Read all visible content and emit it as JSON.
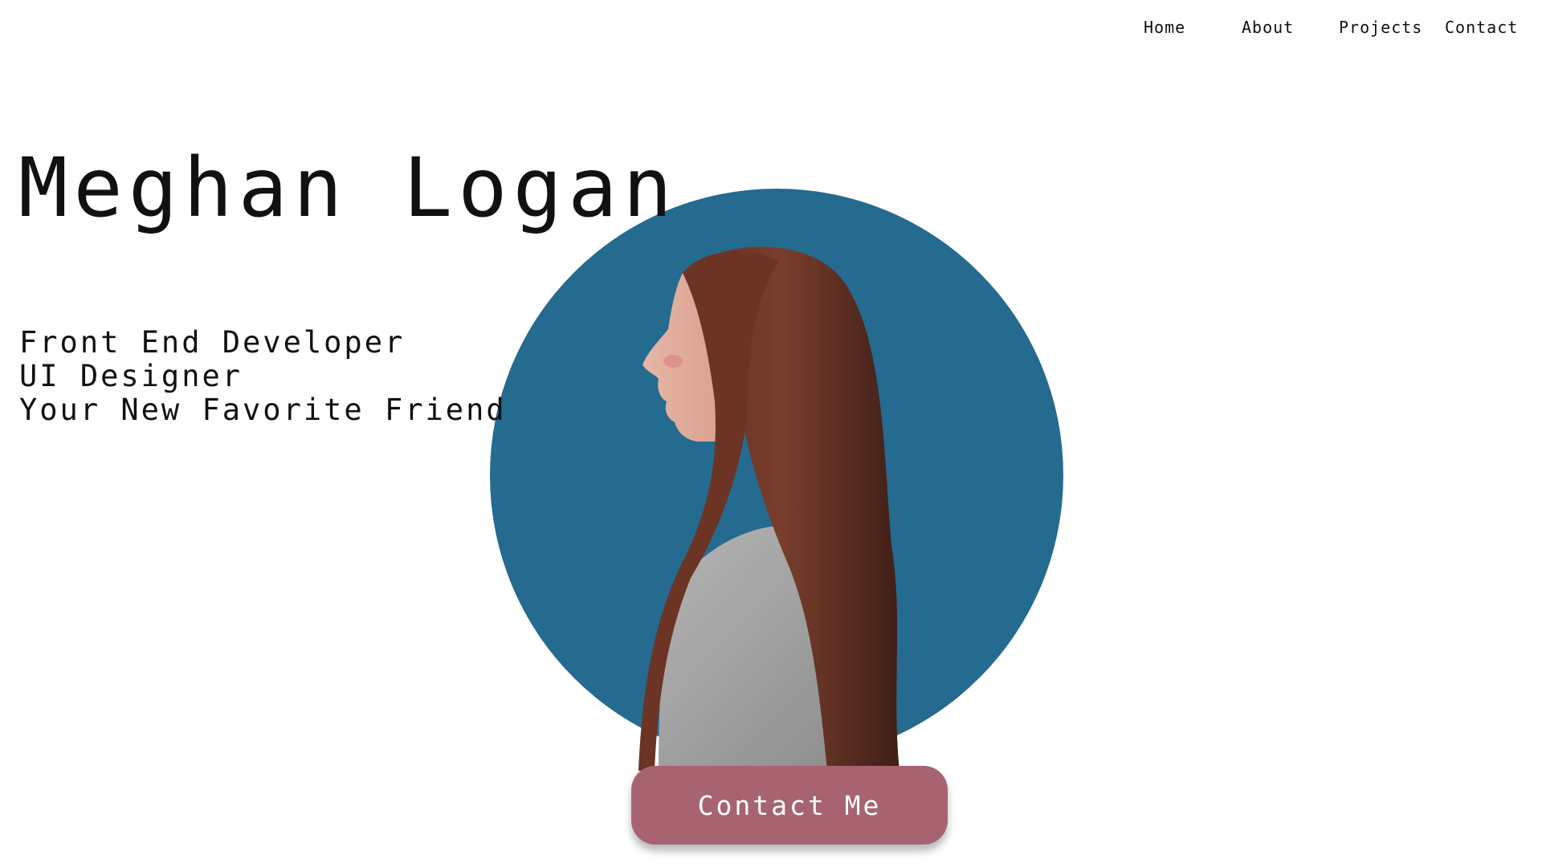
{
  "nav": {
    "items": [
      {
        "label": "Home"
      },
      {
        "label": "About"
      },
      {
        "label": "Projects"
      },
      {
        "label": "Contact"
      }
    ]
  },
  "hero": {
    "name": "Meghan Logan",
    "taglines": [
      "Front End Developer",
      "UI Designer",
      "Your New Favorite Friend"
    ],
    "contact_button_label": "Contact Me"
  },
  "colors": {
    "circle": "#256a8f",
    "button": "#a76470",
    "text": "#111111",
    "background": "#ffffff"
  },
  "portrait": {
    "icon": "profile-photo"
  }
}
